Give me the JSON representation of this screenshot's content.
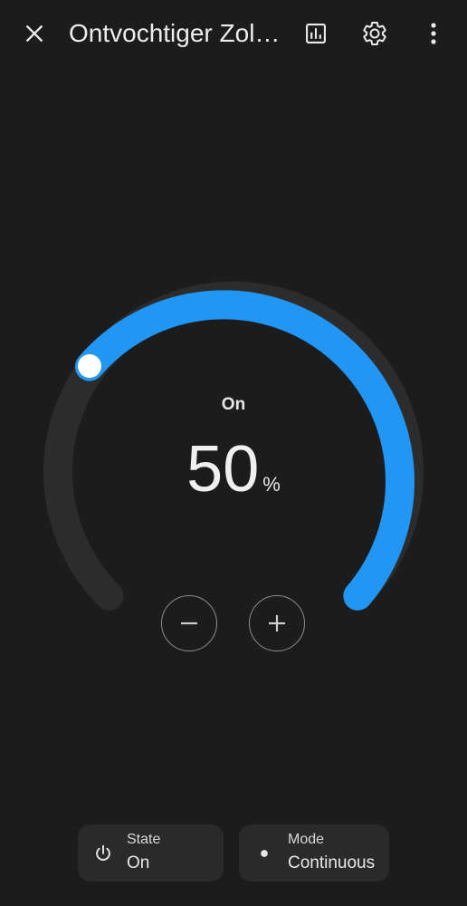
{
  "header": {
    "title": "Ontvochtiger Zolder",
    "close_icon": "close-icon",
    "history_icon": "bar-chart-icon",
    "settings_icon": "gear-icon",
    "more_icon": "more-vert-icon"
  },
  "dial": {
    "state_label": "On",
    "value": "50",
    "unit": "%",
    "level_percent": 50,
    "colors": {
      "active": "#2196f3",
      "track": "#2c2c2c",
      "thumb": "#ffffff"
    }
  },
  "controls": {
    "decrease_icon": "minus-icon",
    "increase_icon": "plus-icon"
  },
  "chips": [
    {
      "icon": "power-icon",
      "label": "State",
      "value": "On"
    },
    {
      "icon": "dot-icon",
      "label": "Mode",
      "value": "Continuous"
    }
  ],
  "colors": {
    "background": "#1c1c1c",
    "chip_background": "#2a2a2a",
    "accent": "#2196f3"
  }
}
